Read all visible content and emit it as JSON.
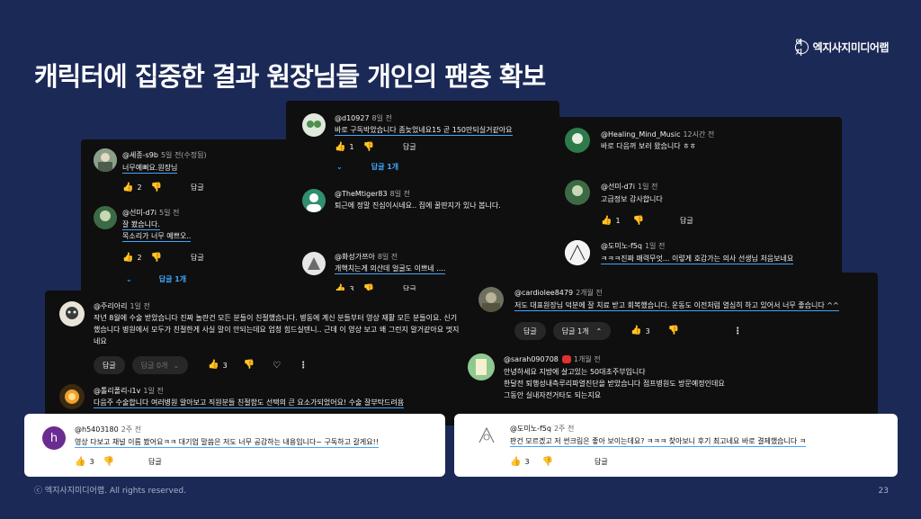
{
  "brand": {
    "name": "엑지사지미디어랩",
    "mark": "엑지"
  },
  "title": "캐릭터에 집중한 결과 원장님들 개인의 팬층 확보",
  "footer": {
    "copyright": "ⓒ 엑지사지미디어랩. All rights reserved.",
    "page": "23"
  },
  "labels": {
    "reply": "답글"
  },
  "card1": {
    "c1": {
      "handle": "@세종-s9b",
      "time": "5일 전(수정됨)",
      "text": "너무예뻐요.원장님",
      "likes": "2"
    },
    "c2": {
      "handle": "@선미-d7i",
      "time": "5일 전",
      "text1": "잘 봤습니다.",
      "text2": "목소리가 너무 예쁘오..",
      "likes": "2",
      "replies": "답글 1개"
    }
  },
  "card2": {
    "c1": {
      "handle": "@d10927",
      "time": "8일 전",
      "text": "바로 구독박았습니다 좀늦었네요15 곧 150만되실거같아요",
      "likes": "1",
      "replies": "답글 1개"
    },
    "c2": {
      "handle": "@TheMtiger83",
      "time": "8일 전",
      "text": "퇴근에 정말 진심이시네요.. 집에 꿀딴지가 있나 봅니다."
    },
    "c3": {
      "handle": "@화성가쯔아",
      "time": "8일 전",
      "text": "개핵치는게 의산데 얼굴도 이쁘네 ....",
      "likes": "3"
    }
  },
  "card3": {
    "c1": {
      "handle": "@Healing_Mind_Music",
      "time": "12시간 전",
      "text": "바로 다음꺼 보러 왔습니다 ㅎㅎ"
    },
    "c2": {
      "handle": "@선미-d7i",
      "time": "1일 전",
      "text": "고급정보 감사합니다",
      "likes": "1"
    },
    "c3": {
      "handle": "@도미노-f5q",
      "time": "1일 전",
      "text": "ㅋㅋㅋ진짜 매력무엇... 이렇게 호감가는 의사 선생님 처음보네요"
    }
  },
  "card4": {
    "c1": {
      "handle": "@주리아리",
      "time": "1일 전",
      "line1": "작년 8월에 수술 받았습니다 진짜 놀란건 모든 분들이 친절했습니다. 병동에 계신 분들부터 영상 재활 모든 분들이요. 신기",
      "line2": "했습니다 병원에서 모두가 친절한게 사실 말이 안되는데요 엄청 힘드실텐니.. 근데 이 영상 보고 왜 그런지 알거같아요 멋지",
      "line3": "네요",
      "replies": "답글 0개",
      "likes": "3"
    },
    "c2": {
      "handle": "@톨리폴리-i1v",
      "time": "1일 전",
      "text": "다음주 수술합니다 여러병원 알아보고 직원분들 친절함도 선택의 큰 요소가되었어요! 수술 잘부탁드려욤"
    }
  },
  "card5": {
    "c1": {
      "handle": "@cardiolee8479",
      "time": "2개월 전",
      "text": "저도 대표원장님 덕분에 잘 치료 받고 회복했습니다. 운동도 이전처럼 열심히 하고 있어서 너무 좋습니다 ^^",
      "replies": "답글 1개",
      "likes": "3"
    },
    "c2": {
      "handle": "@sarah090708",
      "time": "1개월 전",
      "line1": "안녕하세요 지방에 살고있는 50대초주부입니다",
      "line2": "한달전 퇴행성내측루리파열진단을 받았습니다 점프병원도 방문예정인데요",
      "line3": "그동안 실내자전거타도 되는지요"
    }
  },
  "card6": {
    "avatar": "h",
    "handle": "@h5403180",
    "time": "2주 전",
    "text": "영상 다보고 채널 이름 봤어요ㅋㅋ 대기업 말씀은 저도 너무 공감하는 내용입니다~ 구독하고 갈게요!!",
    "likes": "3"
  },
  "card7": {
    "handle": "@도미노-f5q",
    "time": "2주 전",
    "text": "판건 모르겠고 저 썬크림은 좋아 보이는데요? ㅋㅋㅋ 찾아보니 후기 최고네요 바로 결제했습니다 ㅋ",
    "likes": "3"
  },
  "colors": {
    "background": "#1b2956",
    "card_dark": "#0f0f0f",
    "link": "#3ea6ff",
    "avatar_purple": "#6a2c91"
  }
}
